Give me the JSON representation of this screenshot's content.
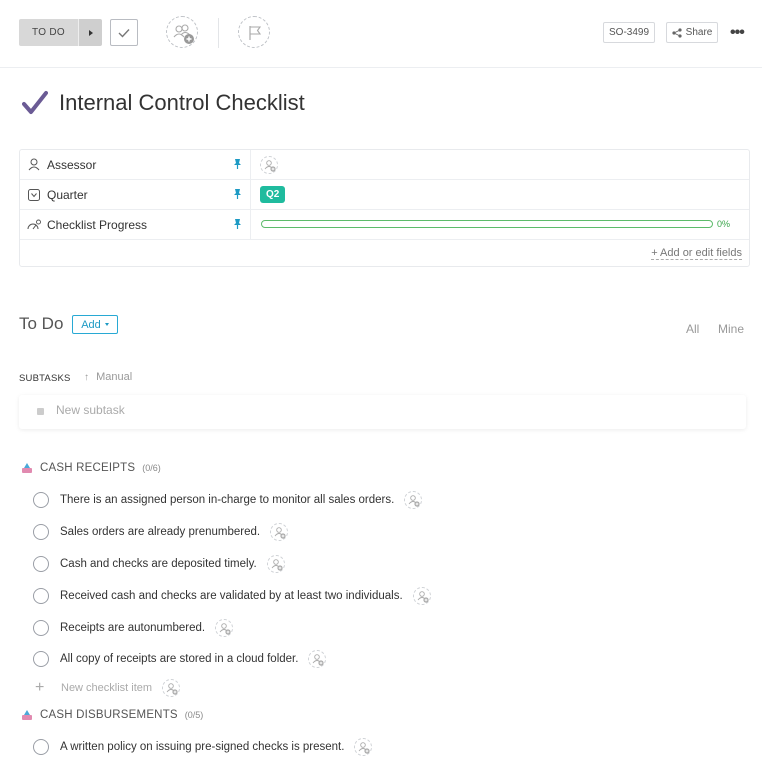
{
  "header": {
    "status_label": "TO DO",
    "task_id": "SO-3499",
    "share_label": "Share"
  },
  "task": {
    "title": "Internal Control Checklist"
  },
  "fields": [
    {
      "label": "Assessor",
      "icon": "person-icon"
    },
    {
      "label": "Quarter",
      "icon": "dropdown-field-icon",
      "value": "Q2",
      "value_color": "#1fbb9e"
    },
    {
      "label": "Checklist Progress",
      "icon": "progress-icon",
      "progress": 0,
      "progress_label": "0%"
    }
  ],
  "edit_fields_label": "+ Add or edit fields",
  "todo": {
    "title": "To Do",
    "add_label": "Add",
    "filter_all": "All",
    "filter_mine": "Mine"
  },
  "subtasks": {
    "label": "SUBTASKS",
    "sort_label": "Manual",
    "new_placeholder": "New subtask"
  },
  "checklists": [
    {
      "name": "CASH RECEIPTS",
      "count": "(0/6)",
      "items": [
        "There is an assigned person in-charge to monitor all sales orders.",
        "Sales orders are already prenumbered.",
        "Cash and checks are deposited timely.",
        "Received cash and checks are validated by at least two individuals.",
        "Receipts are autonumbered.",
        "All copy of receipts are stored in a cloud folder."
      ],
      "new_item_placeholder": "New checklist item"
    },
    {
      "name": "CASH DISBURSEMENTS",
      "count": "(0/5)",
      "items": [
        "A written policy on issuing pre-signed checks is present."
      ]
    }
  ],
  "colors": {
    "accent": "#28a9d4",
    "progress": "#5dbb6b",
    "title_check": "#6b5b95"
  }
}
